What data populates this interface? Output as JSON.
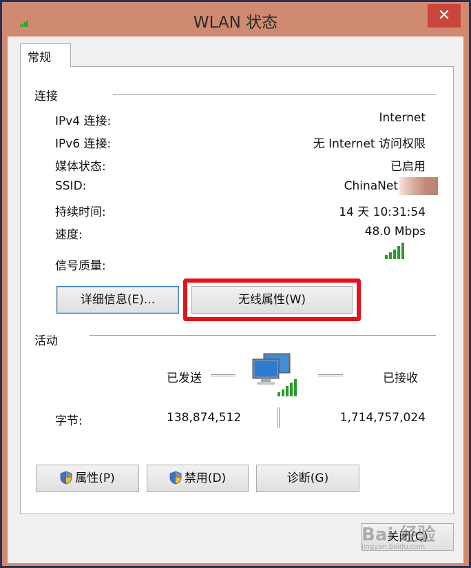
{
  "window": {
    "title": "WLAN 状态",
    "close_glyph": "✕"
  },
  "tabs": [
    {
      "label": "常规"
    }
  ],
  "connection": {
    "section_label": "连接",
    "rows": [
      {
        "label": "IPv4 连接:",
        "value": "Internet"
      },
      {
        "label": "IPv6 连接:",
        "value": "无 Internet 访问权限"
      },
      {
        "label": "媒体状态:",
        "value": "已启用"
      },
      {
        "label": "SSID:",
        "value": "ChinaNet"
      },
      {
        "label": "持续时间:",
        "value": "14 天 10:31:54"
      },
      {
        "label": "速度:",
        "value": "48.0 Mbps"
      }
    ],
    "signal_label": "信号质量:",
    "signal_level": 1.0,
    "details_button": "详细信息(E)...",
    "wireless_props_button": "无线属性(W)"
  },
  "activity": {
    "section_label": "活动",
    "sent_label": "已发送",
    "received_label": "已接收",
    "bytes_label": "字节:",
    "bytes_sent": "138,874,512",
    "bytes_received": "1,714,757,024"
  },
  "buttons": {
    "properties": "属性(P)",
    "disable": "禁用(D)",
    "diagnose": "诊断(G)",
    "close": "关闭(C)"
  },
  "watermark": {
    "text": "Bai 经验",
    "sub": "jingyan.baidu.com"
  },
  "colors": {
    "highlight": "#e4131b",
    "signal": "#2c9a2c",
    "titlebar": "#d08a72"
  }
}
